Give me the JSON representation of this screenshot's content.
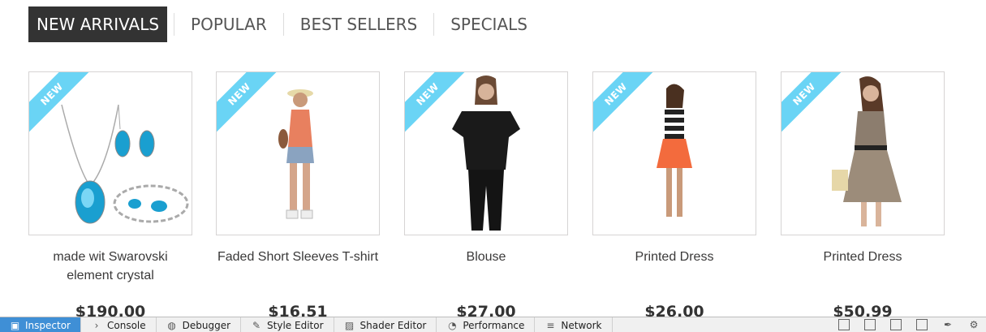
{
  "tabs": [
    {
      "label": "NEW ARRIVALS",
      "active": true
    },
    {
      "label": "POPULAR",
      "active": false
    },
    {
      "label": "BEST SELLERS",
      "active": false
    },
    {
      "label": "SPECIALS",
      "active": false
    }
  ],
  "ribbon_label": "NEW",
  "colors": {
    "ribbon": "#6ad4f5",
    "active_tab": "#333333",
    "devtools_active": "#3f8fd6"
  },
  "products": [
    {
      "name": "made wit Swarovski element crystal",
      "price": "$190.00",
      "image": "jewelry-set"
    },
    {
      "name": "Faded Short Sleeves T-shirt",
      "price": "$16.51",
      "image": "model-orange-top-shorts"
    },
    {
      "name": "Blouse",
      "price": "$27.00",
      "image": "model-black-blouse"
    },
    {
      "name": "Printed Dress",
      "price": "$26.00",
      "image": "model-striped-orange-dress"
    },
    {
      "name": "Printed Dress",
      "price": "$50.99",
      "image": "model-printed-dress"
    }
  ],
  "devtools": {
    "tabs": [
      {
        "label": "Inspector",
        "icon": "inspector-icon",
        "active": true
      },
      {
        "label": "Console",
        "icon": "console-icon",
        "active": false
      },
      {
        "label": "Debugger",
        "icon": "debugger-icon",
        "active": false
      },
      {
        "label": "Style Editor",
        "icon": "style-editor-icon",
        "active": false
      },
      {
        "label": "Shader Editor",
        "icon": "shader-editor-icon",
        "active": false
      },
      {
        "label": "Performance",
        "icon": "performance-icon",
        "active": false
      },
      {
        "label": "Network",
        "icon": "network-icon",
        "active": false
      }
    ]
  }
}
